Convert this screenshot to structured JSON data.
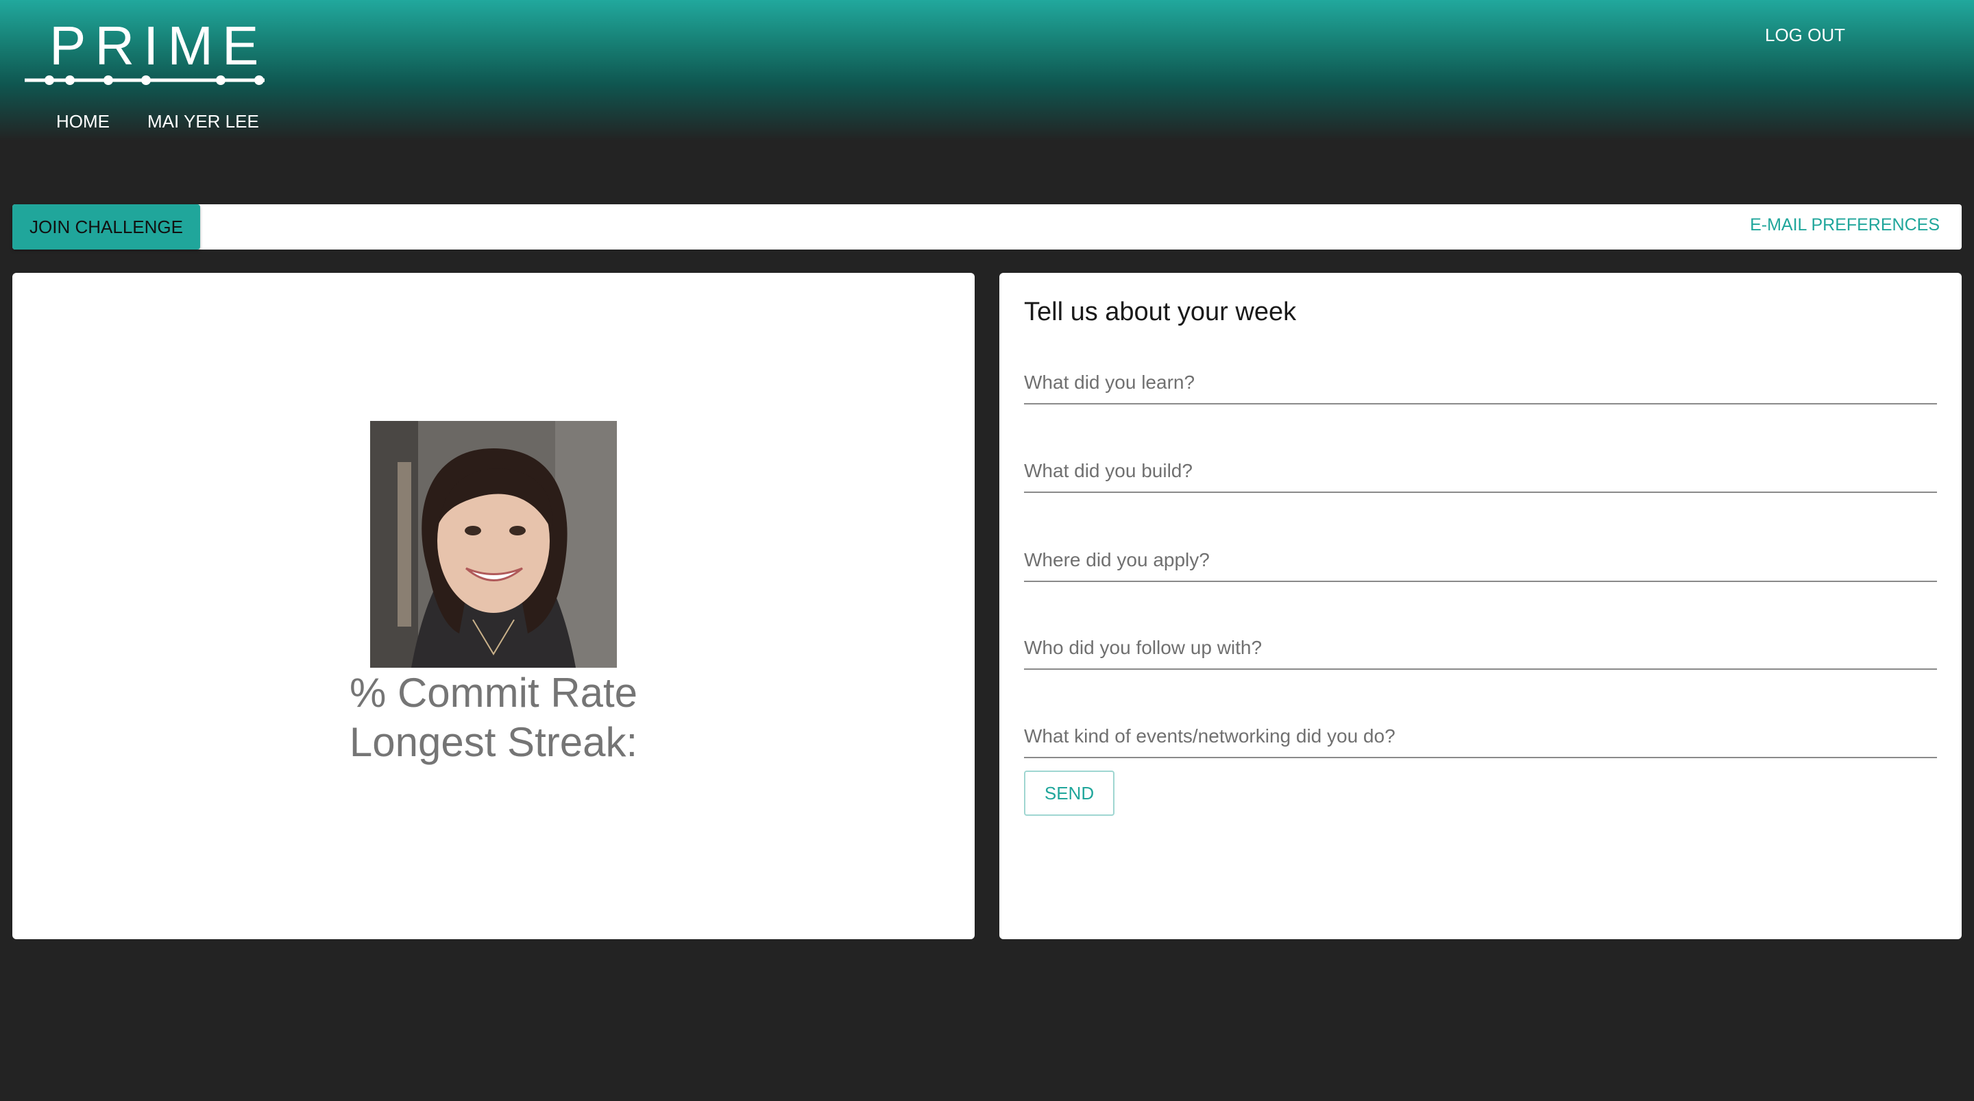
{
  "header": {
    "logo_text": "PRIME",
    "nav": [
      {
        "label": "HOME"
      },
      {
        "label": "MAI YER LEE"
      }
    ],
    "logout_label": "LOG OUT"
  },
  "actionbar": {
    "join_label": "JOIN CHALLENGE",
    "email_pref_label": "E-MAIL PREFERENCES"
  },
  "profile": {
    "commit_rate": "% Commit Rate",
    "longest_streak": "Longest Streak:"
  },
  "form": {
    "title": "Tell us about your week",
    "fields": [
      {
        "placeholder": "What did you learn?"
      },
      {
        "placeholder": "What did you build?"
      },
      {
        "placeholder": "Where did you apply?"
      },
      {
        "placeholder": "Who did you follow up with?"
      },
      {
        "placeholder": "What kind of events/networking did you do?"
      }
    ],
    "send_label": "SEND"
  },
  "colors": {
    "accent": "#20a69b",
    "background": "#232323",
    "card": "#ffffff"
  }
}
